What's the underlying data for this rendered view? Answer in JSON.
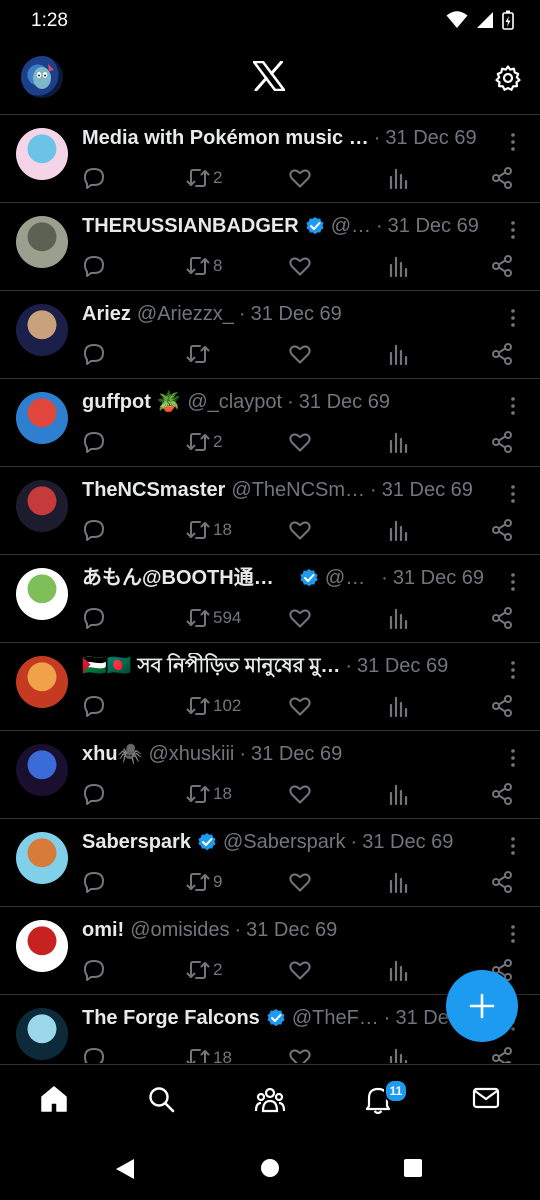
{
  "status_bar": {
    "time": "1:28"
  },
  "header": {
    "logo": "x-logo",
    "settings_icon": "gear-icon",
    "avatar": "account-avatar"
  },
  "feed": [
    {
      "name": "Media with Pokémon music …",
      "verified": false,
      "handle": "",
      "date": "31 Dec 69",
      "reposts": "2",
      "avatar_colors": [
        "#f6d4e8",
        "#6bc4e8"
      ]
    },
    {
      "name": "THERUSSIANBADGER",
      "verified": true,
      "handle": "@…",
      "date": "31 Dec 69",
      "reposts": "8",
      "avatar_colors": [
        "#9aa08e",
        "#5d6153"
      ]
    },
    {
      "name": "Ariez",
      "verified": false,
      "handle": "@Ariezzx_",
      "date": "31 Dec 69",
      "reposts": "",
      "avatar_colors": [
        "#1c1f4a",
        "#c8a27a"
      ]
    },
    {
      "name": "guffpot 🪴",
      "verified": false,
      "handle": "@_claypot",
      "date": "31 Dec 69",
      "reposts": "2",
      "avatar_colors": [
        "#2f7fd1",
        "#e0463a"
      ]
    },
    {
      "name": "TheNCSmaster",
      "verified": false,
      "handle": "@TheNCSm…",
      "date": "31 Dec 69",
      "reposts": "18",
      "avatar_colors": [
        "#1c1c2e",
        "#c53a3a"
      ]
    },
    {
      "name": "あもん@BOOTH通販中",
      "verified": true,
      "handle": "@a…",
      "date": "31 Dec 69",
      "reposts": "594",
      "avatar_colors": [
        "#ffffff",
        "#7fbf5a"
      ]
    },
    {
      "name": "🇵🇸🇧🇩 সব নিপীড়িত মানুষের মু…",
      "verified": false,
      "handle": "",
      "date": "31 Dec 69",
      "reposts": "102",
      "avatar_colors": [
        "#c63a22",
        "#f0a24a"
      ]
    },
    {
      "name": "xhu🕷️",
      "verified": false,
      "handle": "@xhuskiii",
      "date": "31 Dec 69",
      "reposts": "18",
      "avatar_colors": [
        "#1a0f2e",
        "#3a6bd8"
      ]
    },
    {
      "name": "Saberspark",
      "verified": true,
      "handle": "@Saberspark",
      "date": "31 Dec 69",
      "reposts": "9",
      "avatar_colors": [
        "#7fd0e8",
        "#d77a3a"
      ]
    },
    {
      "name": "omi!",
      "verified": false,
      "handle": "@omisides",
      "date": "31 Dec 69",
      "reposts": "2",
      "avatar_colors": [
        "#ffffff",
        "#c7221f"
      ]
    },
    {
      "name": "The Forge Falcons",
      "verified": true,
      "handle": "@TheF…",
      "date": "31 De",
      "reposts": "18",
      "avatar_colors": [
        "#0d2a3a",
        "#9ad7e8"
      ]
    }
  ],
  "bottom_nav": {
    "notifications_badge": "11"
  },
  "colors": {
    "accent": "#1d9bf0",
    "muted": "#71767b",
    "divider": "#2f3336",
    "background": "#000000"
  }
}
